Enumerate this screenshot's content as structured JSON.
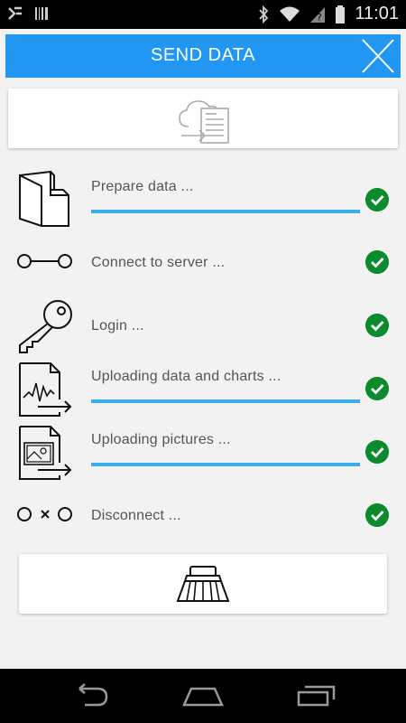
{
  "status_bar": {
    "time": "11:01",
    "icons": [
      "bluetooth-icon",
      "wifi-icon",
      "signal-icon",
      "battery-icon"
    ]
  },
  "app_bar": {
    "title": "SEND DATA",
    "close_icon": "close-icon"
  },
  "header_card": {
    "icon": "cloud-upload-document-icon"
  },
  "steps": [
    {
      "label": "Prepare data  ...",
      "icon": "document-folder-icon",
      "progress": 1.0,
      "done": true
    },
    {
      "label": "Connect to server ...",
      "icon": "connect-icon",
      "done": true
    },
    {
      "label": "Login ...",
      "icon": "key-icon",
      "done": true
    },
    {
      "label": "Uploading data and charts ...",
      "icon": "chart-document-upload-icon",
      "progress": 1.0,
      "done": true
    },
    {
      "label": "Uploading pictures ...",
      "icon": "picture-document-upload-icon",
      "progress": 1.0,
      "done": true
    },
    {
      "label": "Disconnect ...",
      "icon": "disconnect-icon",
      "done": true
    }
  ],
  "bottom_card": {
    "icon": "cleanup-brush-icon"
  },
  "colors": {
    "accent": "#2196f3",
    "progress": "#3aaee8",
    "success": "#0c8a2e"
  },
  "nav_bar": {
    "icons": [
      "back-icon",
      "home-icon",
      "recents-icon"
    ]
  }
}
